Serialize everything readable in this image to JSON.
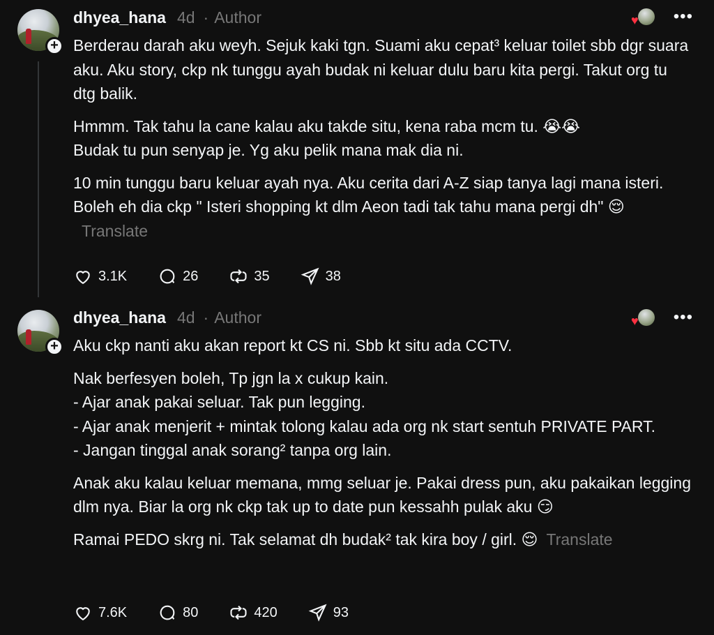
{
  "posts": [
    {
      "username": "dhyea_hana",
      "time": "4d",
      "separator": "·",
      "role": "Author",
      "paragraphs": [
        "Berderau darah aku weyh. Sejuk kaki tgn. Suami aku cepat³ keluar toilet sbb dgr suara aku. Aku story, ckp nk tunggu ayah budak ni keluar dulu baru kita pergi. Takut org tu dtg balik.",
        "Hmmm. Tak tahu la cane kalau aku takde situ, kena raba mcm tu. 😭😭\nBudak tu pun senyap je. Yg aku pelik mana mak dia ni.",
        "10 min tunggu baru keluar ayah nya. Aku cerita dari A-Z siap tanya lagi mana isteri. Boleh eh dia ckp \" Isteri shopping kt dlm Aeon tadi tak tahu mana pergi dh\" 😌"
      ],
      "translate_label": "Translate",
      "likes": "3.1K",
      "comments": "26",
      "reposts": "35",
      "shares": "38"
    },
    {
      "username": "dhyea_hana",
      "time": "4d",
      "separator": "·",
      "role": "Author",
      "paragraphs": [
        "Aku ckp nanti aku akan report kt CS ni. Sbb kt situ ada CCTV.",
        "Nak berfesyen boleh, Tp jgn la x cukup kain.\n- Ajar anak pakai seluar. Tak pun legging.\n- Ajar anak menjerit + mintak tolong kalau ada org nk start sentuh PRIVATE PART.\n- Jangan tinggal anak sorang² tanpa org lain.",
        "Anak aku kalau keluar memana, mmg seluar je. Pakai dress pun, aku pakaikan legging dlm nya. Biar la org nk ckp tak up to date pun kessahh pulak aku 😏",
        "Ramai PEDO skrg ni. Tak selamat dh budak² tak kira boy / girl. 😌"
      ],
      "translate_label": "Translate",
      "likes": "7.6K",
      "comments": "80",
      "reposts": "420",
      "shares": "93"
    }
  ],
  "icons": {
    "like": "heart-outline-icon",
    "comment": "comment-bubble-icon",
    "repost": "repost-icon",
    "share": "send-icon",
    "more": "more-dots-icon",
    "follow": "plus-icon"
  },
  "colors": {
    "background": "#101010",
    "text": "#f3f5f7",
    "muted": "#777777",
    "liked_heart": "#ff3040"
  }
}
